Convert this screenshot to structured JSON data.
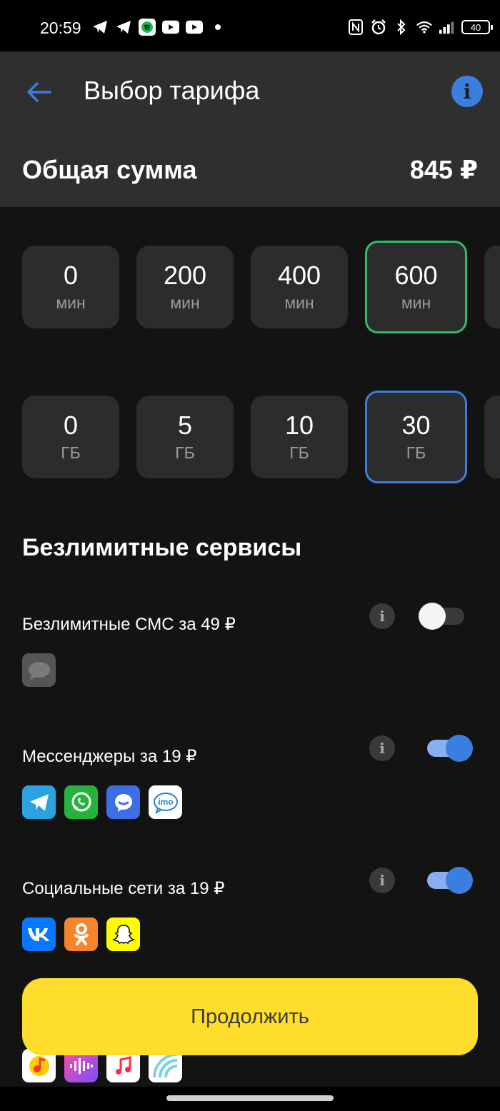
{
  "status_bar": {
    "time": "20:59",
    "battery": "40",
    "left_icons": [
      "telegram-icon",
      "telegram-icon",
      "spotify-icon",
      "youtube-icon",
      "youtube-icon",
      "dot-icon"
    ],
    "right_icons": [
      "nfc-icon",
      "alarm-icon",
      "bluetooth-icon",
      "wifi-icon",
      "signal-icon"
    ]
  },
  "header": {
    "title": "Выбор тарифа",
    "total_label": "Общая сумма",
    "total_value": "845 ₽"
  },
  "minutes": {
    "options": [
      {
        "value": "0",
        "unit": "мин"
      },
      {
        "value": "200",
        "unit": "мин"
      },
      {
        "value": "400",
        "unit": "мин"
      },
      {
        "value": "600",
        "unit": "мин"
      }
    ],
    "selected": "600"
  },
  "gigabytes": {
    "options": [
      {
        "value": "0",
        "unit": "ГБ"
      },
      {
        "value": "5",
        "unit": "ГБ"
      },
      {
        "value": "10",
        "unit": "ГБ"
      },
      {
        "value": "30",
        "unit": "ГБ"
      }
    ],
    "selected": "30"
  },
  "unlimited": {
    "title": "Безлимитные сервисы",
    "services": [
      {
        "label": "Безлимитные СМС за 49 ₽",
        "enabled": false,
        "apps": [
          "sms-icon"
        ]
      },
      {
        "label": "Мессенджеры за 19 ₽",
        "enabled": true,
        "apps": [
          "telegram-icon",
          "whatsapp-icon",
          "messenger-icon",
          "imo-icon"
        ]
      },
      {
        "label": "Социальные сети за 19 ₽",
        "enabled": true,
        "apps": [
          "vk-icon",
          "odnoklassniki-icon",
          "snapchat-icon"
        ]
      }
    ],
    "music_apps": [
      "yandex-music-icon",
      "zvuk-icon",
      "apple-music-icon",
      "podcast-icon"
    ],
    "imo_text": "imo"
  },
  "actions": {
    "continue_label": "Продолжить"
  },
  "colors": {
    "accent_blue": "#3a7fe0",
    "selected_green": "#2dbe64",
    "cta_yellow": "#fedd2c",
    "header_bg": "#2f2f2f",
    "page_bg": "#131313"
  }
}
